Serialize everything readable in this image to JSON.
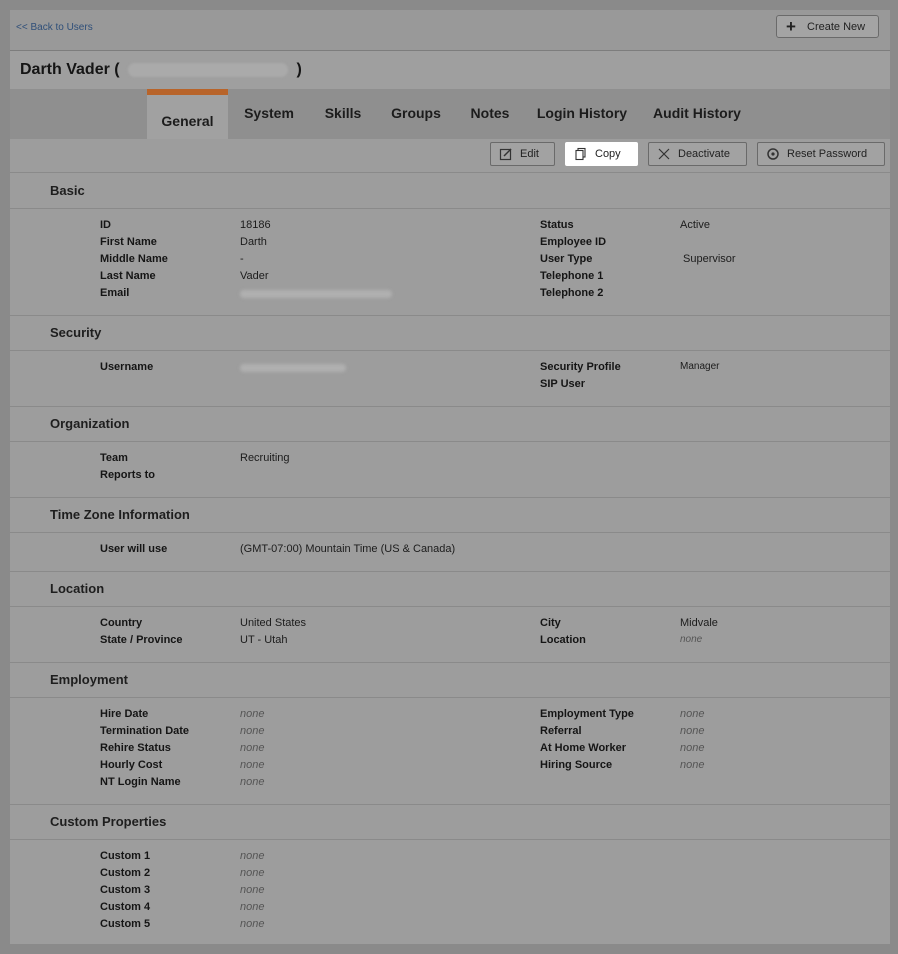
{
  "header": {
    "back_link": "<< Back to Users",
    "create_new": "Create New",
    "user_name": "Darth Vader (",
    "user_name_close": ")"
  },
  "tabs": [
    {
      "label": "General",
      "active": true
    },
    {
      "label": "System"
    },
    {
      "label": "Skills"
    },
    {
      "label": "Groups"
    },
    {
      "label": "Notes"
    },
    {
      "label": "Login History"
    },
    {
      "label": "Audit History"
    }
  ],
  "actions": {
    "edit": "Edit",
    "copy": "Copy",
    "deactivate": "Deactivate",
    "reset_password": "Reset Password"
  },
  "sections": {
    "basic": {
      "title": "Basic",
      "id_label": "ID",
      "id_value": "18186",
      "first_name_label": "First Name",
      "first_name_value": "Darth",
      "middle_name_label": "Middle Name",
      "middle_name_value": "-",
      "last_name_label": "Last Name",
      "last_name_value": "Vader",
      "email_label": "Email",
      "status_label": "Status",
      "status_value": "Active",
      "employee_id_label": "Employee ID",
      "user_type_label": "User Type",
      "user_type_value": "Supervisor",
      "telephone1_label": "Telephone 1",
      "telephone2_label": "Telephone 2"
    },
    "security": {
      "title": "Security",
      "username_label": "Username",
      "security_profile_label": "Security Profile",
      "security_profile_value": "Manager",
      "sip_user_label": "SIP User"
    },
    "organization": {
      "title": "Organization",
      "team_label": "Team",
      "team_value": "Recruiting",
      "reports_to_label": "Reports to"
    },
    "timezone": {
      "title": "Time Zone Information",
      "user_will_use_label": "User will use",
      "user_will_use_value": "(GMT-07:00) Mountain Time (US & Canada)"
    },
    "location": {
      "title": "Location",
      "country_label": "Country",
      "country_value": "United States",
      "state_label": "State / Province",
      "state_value": "UT - Utah",
      "city_label": "City",
      "city_value": "Midvale",
      "location_label": "Location",
      "location_value": "none"
    },
    "employment": {
      "title": "Employment",
      "hire_date_label": "Hire Date",
      "hire_date_value": "none",
      "termination_date_label": "Termination Date",
      "termination_date_value": "none",
      "rehire_status_label": "Rehire Status",
      "rehire_status_value": "none",
      "hourly_cost_label": "Hourly Cost",
      "hourly_cost_value": "none",
      "nt_login_label": "NT Login Name",
      "nt_login_value": "none",
      "employment_type_label": "Employment Type",
      "employment_type_value": "none",
      "referral_label": "Referral",
      "referral_value": "none",
      "at_home_worker_label": "At Home Worker",
      "at_home_worker_value": "none",
      "hiring_source_label": "Hiring Source",
      "hiring_source_value": "none"
    },
    "custom": {
      "title": "Custom Properties",
      "items": [
        {
          "label": "Custom 1",
          "value": "none"
        },
        {
          "label": "Custom 2",
          "value": "none"
        },
        {
          "label": "Custom 3",
          "value": "none"
        },
        {
          "label": "Custom 4",
          "value": "none"
        },
        {
          "label": "Custom 5",
          "value": "none"
        }
      ]
    }
  }
}
